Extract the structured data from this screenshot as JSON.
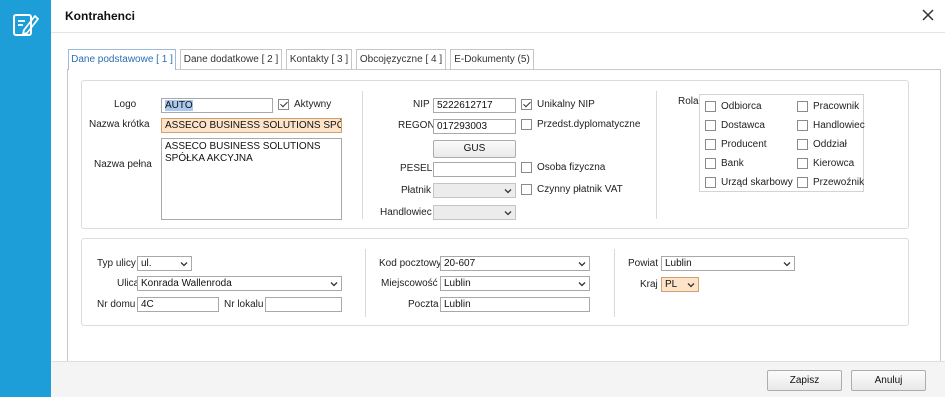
{
  "window": {
    "title": "Kontrahenci",
    "close_icon": "close-icon",
    "app_icon": "edit-document-icon",
    "accent_color": "#1e9ed8"
  },
  "tabs": [
    {
      "label": "Dane podstawowe [ 1 ]",
      "active": true
    },
    {
      "label": "Dane dodatkowe [ 2 ]",
      "active": false
    },
    {
      "label": "Kontakty [ 3 ]",
      "active": false
    },
    {
      "label": "Obcojęzyczne [ 4 ]",
      "active": false
    },
    {
      "label": "E-Dokumenty (5)",
      "active": false
    }
  ],
  "basic": {
    "logo_label": "Logo",
    "logo_value": "AUTO",
    "active_label": "Aktywny",
    "active_checked": true,
    "short_name_label": "Nazwa krótka",
    "short_name_value": "ASSECO BUSINESS SOLUTIONS SPÓŁKA A",
    "full_name_label": "Nazwa pełna",
    "full_name_value": "ASSECO BUSINESS SOLUTIONS SPÓŁKA AKCYJNA"
  },
  "ids": {
    "nip_label": "NIP",
    "nip_value": "5222612717",
    "unique_nip_label": "Unikalny NIP",
    "unique_nip_checked": true,
    "regon_label": "REGON",
    "regon_value": "017293003",
    "diplomatic_label": "Przedst.dyplomatyczne",
    "gus_button": "GUS",
    "pesel_label": "PESEL",
    "pesel_value": "",
    "natural_person_label": "Osoba fizyczna",
    "payer_label": "Płatnik",
    "payer_value": "",
    "vat_payer_label": "Czynny płatnik VAT",
    "salesman_label": "Handlowiec",
    "salesman_value": ""
  },
  "roles": {
    "label": "Rola",
    "left": [
      "Odbiorca",
      "Dostawca",
      "Producent",
      "Bank",
      "Urząd skarbowy"
    ],
    "right": [
      "Pracownik",
      "Handlowiec",
      "Oddział",
      "Kierowca",
      "Przewoźnik"
    ]
  },
  "address": {
    "street_type_label": "Typ ulicy",
    "street_type_value": "ul.",
    "street_label": "Ulica",
    "street_value": "Konrada Wallenroda",
    "house_no_label": "Nr domu",
    "house_no_value": "4C",
    "flat_no_label": "Nr lokalu",
    "flat_no_value": "",
    "postal_label": "Kod pocztowy",
    "postal_value": "20-607",
    "city_label": "Miejscowość",
    "city_value": "Lublin",
    "post_label": "Poczta",
    "post_value": "Lublin",
    "county_label": "Powiat",
    "county_value": "Lublin",
    "country_label": "Kraj",
    "country_value": "PL"
  },
  "footer": {
    "save_label": "Zapisz",
    "cancel_label": "Anuluj"
  }
}
